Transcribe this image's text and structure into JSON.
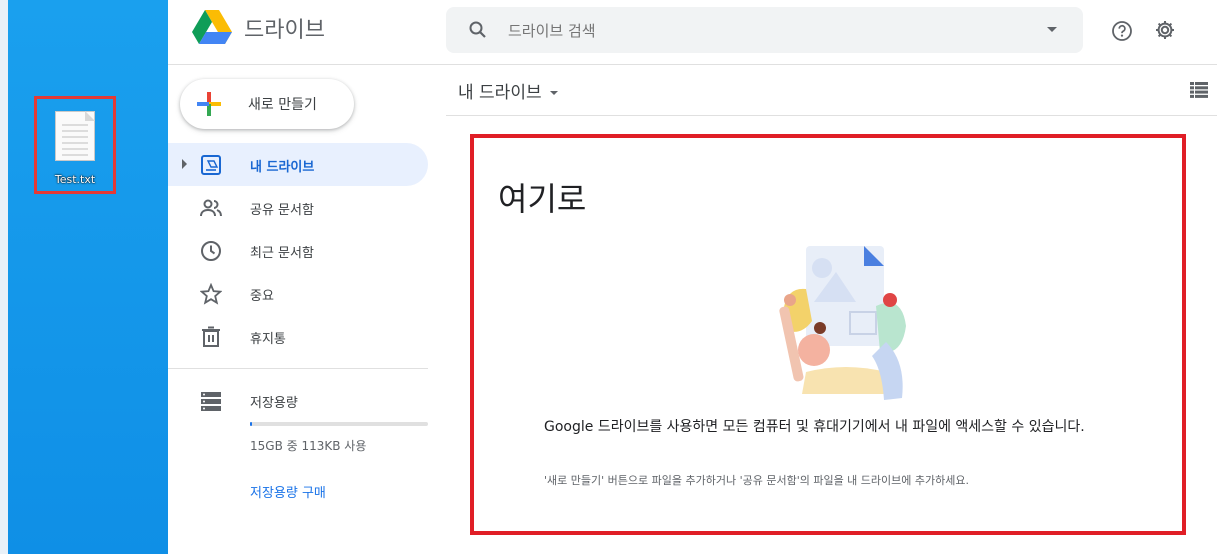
{
  "desktop": {
    "file_label": "Test.txt",
    "background_color": "#1aa0ee",
    "highlight_color": "#e53935"
  },
  "header": {
    "app_title": "드라이브",
    "search_placeholder": "드라이브 검색",
    "icons": [
      "drive-logo-icon",
      "search-icon",
      "dropdown-caret-icon",
      "help-icon",
      "gear-icon"
    ]
  },
  "sidebar": {
    "new_button_label": "새로 만들기",
    "items": [
      {
        "label": "내 드라이브",
        "icon": "my-drive-icon",
        "active": true
      },
      {
        "label": "공유 문서함",
        "icon": "shared-people-icon",
        "active": false
      },
      {
        "label": "최근 문서함",
        "icon": "clock-icon",
        "active": false
      },
      {
        "label": "중요",
        "icon": "star-icon",
        "active": false
      },
      {
        "label": "휴지통",
        "icon": "trash-icon",
        "active": false
      }
    ],
    "storage": {
      "label": "저장용량",
      "usage_text": "15GB 중 113KB 사용",
      "buy_label": "저장용량 구매",
      "fill_fraction": 0.01
    }
  },
  "main": {
    "breadcrumb": "내 드라이브",
    "dropzone": {
      "title": "여기로",
      "message": "Google 드라이브를 사용하면 모든 컴퓨터 및 휴대기기에서 내 파일에 액세스할 수 있습니다.",
      "sub_message": "'새로 만들기' 버튼으로 파일을 추가하거나 '공유 문서함'의 파일을 내 드라이브에 추가하세요.",
      "border_color": "#e01e26"
    }
  },
  "colors": {
    "accent": "#1a73e8",
    "active_bg": "#e8f0fe",
    "active_text": "#1967d2"
  }
}
